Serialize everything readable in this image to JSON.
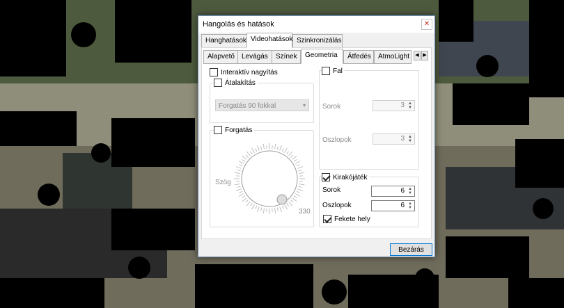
{
  "dialog": {
    "title": "Hangolás és hatások",
    "close_glyph": "✕"
  },
  "main_tabs": [
    "Hanghatások",
    "Videohatások",
    "Szinkronizálás"
  ],
  "sub_tabs": [
    "Alapvető",
    "Levágás",
    "Színek",
    "Geometria",
    "Átfedés",
    "AtmoLight"
  ],
  "sub_tab_scroll": {
    "left": "◀",
    "right": "▶"
  },
  "geometry": {
    "interactive_zoom": {
      "label": "Interaktív nagyítás",
      "checked": false
    },
    "transform": {
      "label": "Átalakítás",
      "checked": false,
      "select_value": "Forgatás 90 fokkal",
      "select_arrow": "▾"
    },
    "rotate": {
      "label": "Forgatás",
      "checked": false,
      "angle_label": "Szög",
      "angle_value": "330"
    },
    "wall": {
      "label": "Fal",
      "checked": false,
      "rows_label": "Sorok",
      "rows_value": "3",
      "cols_label": "Oszlopok",
      "cols_value": "3"
    },
    "puzzle": {
      "label": "Kirakójáték",
      "checked": true,
      "rows_label": "Sorok",
      "rows_value": "6",
      "cols_label": "Oszlopok",
      "cols_value": "6",
      "black_slot_label": "Fekete hely",
      "black_slot_checked": true
    }
  },
  "spin_arrows": "▲\n▼",
  "footer": {
    "close_label": "Bezárás"
  }
}
